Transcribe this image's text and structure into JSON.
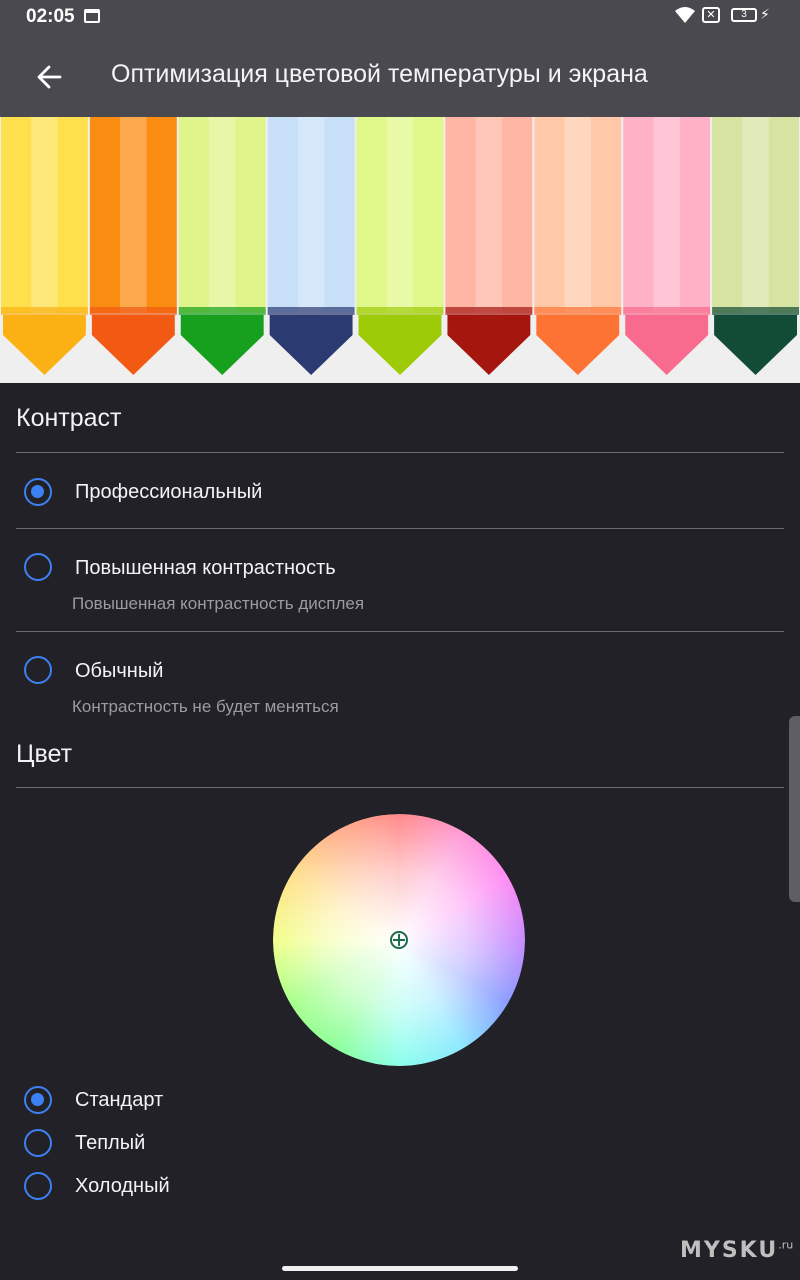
{
  "status_bar": {
    "time": "02:05",
    "battery_level": "3",
    "icons": [
      "calendar-icon",
      "wifi-icon",
      "no-sim-icon",
      "battery-icon",
      "charging-icon"
    ]
  },
  "app_bar": {
    "title": "Оптимизация цветовой температуры и экрана",
    "back_icon": "arrow-back-icon"
  },
  "banner": {
    "crayon_colors": [
      {
        "body": "#fde04c",
        "tip": "#fbb114"
      },
      {
        "body": "#fb8c12",
        "tip": "#f25a14"
      },
      {
        "body": "#dff48a",
        "tip": "#16a01e"
      },
      {
        "body": "#c7e0f8",
        "tip": "#2c3a72"
      },
      {
        "body": "#e0f88a",
        "tip": "#9ecb08"
      },
      {
        "body": "#ffb5a3",
        "tip": "#a5160f"
      },
      {
        "body": "#ffc9a8",
        "tip": "#fd7334"
      },
      {
        "body": "#ffb2c6",
        "tip": "#f86a8e"
      },
      {
        "body": "#d6e3a3",
        "tip": "#124b36"
      }
    ]
  },
  "contrast": {
    "title": "Контраст",
    "options": [
      {
        "label": "Профессиональный",
        "subtitle": "",
        "selected": true
      },
      {
        "label": "Повышенная контрастность",
        "subtitle": "Повышенная контрастность дисплея",
        "selected": false
      },
      {
        "label": "Обычный",
        "subtitle": "Контрастность не будет меняться",
        "selected": false
      }
    ]
  },
  "color": {
    "title": "Цвет",
    "wheel_center_icon": "crosshair-plus-icon",
    "options": [
      {
        "label": "Стандарт",
        "selected": true
      },
      {
        "label": "Теплый",
        "selected": false
      },
      {
        "label": "Холодный",
        "selected": false
      }
    ]
  },
  "watermark": {
    "text": "MYSKU",
    "suffix": ".ru"
  },
  "colors": {
    "accent": "#3d80f2",
    "background": "#222127",
    "app_bar": "#4a494f"
  }
}
